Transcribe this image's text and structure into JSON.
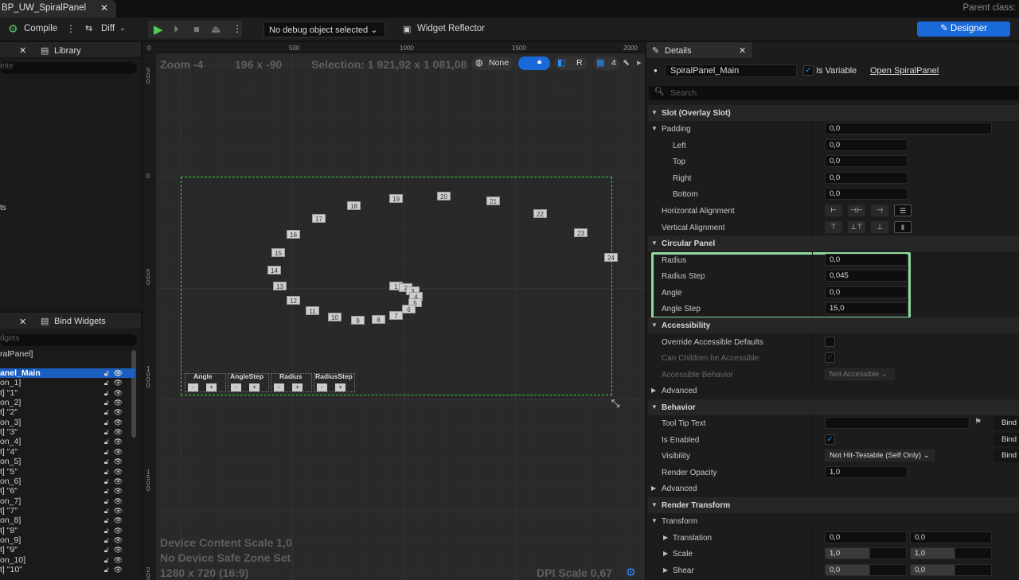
{
  "window": {
    "tab_title": "BP_UW_SpiralPanel",
    "parent_class": "Parent class:"
  },
  "toolbar": {
    "compile": "Compile",
    "diff": "Diff",
    "debug_object": "No debug object selected",
    "widget_reflector": "Widget Reflector",
    "designer": "Designer"
  },
  "left_top": {
    "library_tab": "Library",
    "search_placeholder": "ette",
    "partial_label": "ts"
  },
  "left_bottom": {
    "bind_widgets_tab": "Bind Widgets",
    "search_placeholder": "dgets",
    "root": "ralPanel]",
    "items": [
      "anel_Main",
      "on_1]",
      "t] \"1\"",
      "on_2]",
      "t] \"2\"",
      "on_3]",
      "t] \"3\"",
      "on_4]",
      "t] \"4\"",
      "on_5]",
      "t] \"5\"",
      "on_6]",
      "t] \"6\"",
      "on_7]",
      "t] \"7\"",
      "on_8]",
      "t] \"8\"",
      "on_9]",
      "t] \"9\"",
      "on_10]",
      "t] \"10\""
    ]
  },
  "canvas": {
    "zoom": "Zoom -4",
    "cursor": "196 x -90",
    "selection": "Selection: 1 921,92 x 1 081,08",
    "none_label": "None",
    "r_label": "R",
    "grid_value": "4",
    "device_scale": "Device Content Scale 1,0",
    "safe_zone": "No Device Safe Zone Set",
    "resolution": "1280 x 720 (16:9)",
    "dpi_scale": "DPI Scale 0,67",
    "ruler_top": [
      "0",
      "500",
      "1000",
      "1500",
      "2000"
    ],
    "ruler_left": [
      "500",
      "0",
      "500",
      "1000",
      "1500",
      "200"
    ],
    "spiral_items": [
      "1",
      "2",
      "3",
      "4",
      "5",
      "6",
      "7",
      "8",
      "9",
      "10",
      "11",
      "12",
      "13",
      "14",
      "15",
      "16",
      "17",
      "18",
      "19",
      "20",
      "21",
      "22",
      "23",
      "24"
    ],
    "controls": [
      {
        "label": "Angle"
      },
      {
        "label": "AngleStep"
      },
      {
        "label": "Radius"
      },
      {
        "label": "RadiusStep"
      }
    ],
    "minus": "-",
    "plus": "+"
  },
  "details": {
    "tab": "Details",
    "widget_name": "SpiralPanel_Main",
    "is_variable": "Is Variable",
    "open_link": "Open SpiralPanel",
    "search_placeholder": "Search",
    "slot_section": "Slot (Overlay Slot)",
    "padding": "Padding",
    "padding_value": "0,0",
    "left": "Left",
    "left_value": "0,0",
    "top": "Top",
    "top_value": "0,0",
    "right": "Right",
    "right_value": "0,0",
    "bottom": "Bottom",
    "bottom_value": "0,0",
    "h_align": "Horizontal Alignment",
    "v_align": "Vertical Alignment",
    "circular_section": "Circular Panel",
    "radius": "Radius",
    "radius_value": "0,0",
    "radius_step": "Radius Step",
    "radius_step_value": "0,045",
    "angle": "Angle",
    "angle_value": "0,0",
    "angle_step": "Angle Step",
    "angle_step_value": "15,0",
    "accessibility_section": "Accessibility",
    "override_access": "Override Accessible Defaults",
    "children_access": "Can Children be Accessible",
    "access_behavior": "Accessible Behavior",
    "access_behavior_value": "Not Accessible",
    "advanced": "Advanced",
    "behavior_section": "Behavior",
    "tooltip": "Tool Tip Text",
    "is_enabled": "Is Enabled",
    "visibility": "Visibility",
    "visibility_value": "Not Hit-Testable (Self Only)",
    "render_opacity": "Render Opacity",
    "render_opacity_value": "1,0",
    "bind": "Bind",
    "render_transform_section": "Render Transform",
    "transform": "Transform",
    "translation": "Translation",
    "translation_x": "0,0",
    "translation_y": "0,0",
    "scale": "Scale",
    "scale_x": "1,0",
    "scale_y": "1,0",
    "shear": "Shear",
    "shear_x": "0,0",
    "shear_y": "0,0"
  },
  "colors": {
    "accent": "#1a69d8",
    "selection_green": "#3bd13b",
    "highlight_box": "#8fd8a0"
  }
}
